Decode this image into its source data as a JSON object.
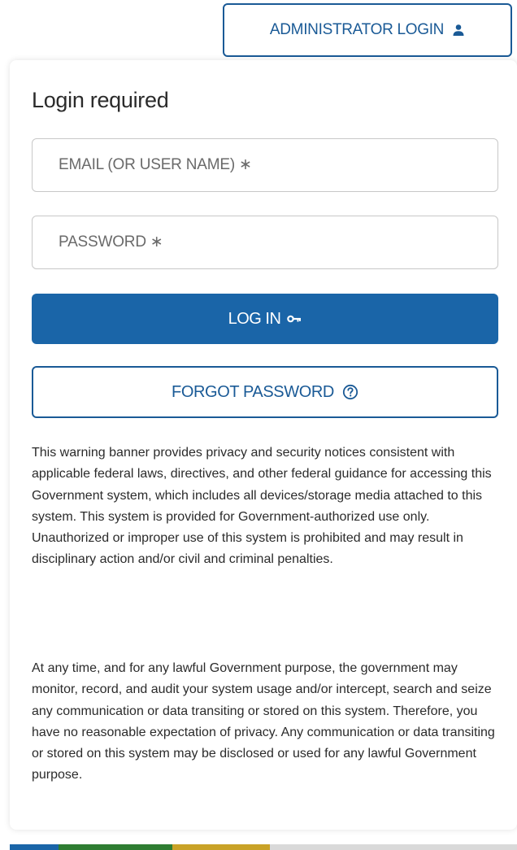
{
  "header": {
    "admin_login_label": "ADMINISTRATOR LOGIN"
  },
  "login": {
    "title": "Login required",
    "email_placeholder": "EMAIL (OR USER NAME) ∗",
    "password_placeholder": "PASSWORD ∗",
    "login_button_label": "LOG IN",
    "forgot_password_label": "FORGOT PASSWORD"
  },
  "notice": {
    "paragraph1": "This warning banner provides privacy and security notices consistent with applicable federal laws, directives, and other federal guidance for accessing this Government system, which includes all devices/storage media attached to this system. This system is provided for Government-authorized use only. Unauthorized or improper use of this system is prohibited and may result in disciplinary action and/or civil and criminal penalties.",
    "paragraph2": "At any time, and for any lawful Government purpose, the government may monitor, record, and audit your system usage and/or intercept, search and seize any communication or data transiting or stored on this system. Therefore, you have no reasonable expectation of privacy. Any communication or data transiting or stored on this system may be disclosed or used for any lawful Government purpose."
  },
  "icons": {
    "admin": "person-icon",
    "login": "key-icon",
    "forgot": "help-circle-icon"
  },
  "colors": {
    "primary": "#1a65a8",
    "outline": "#1a5a96",
    "text": "#2b2b2b",
    "placeholder": "#6a6a6a"
  }
}
